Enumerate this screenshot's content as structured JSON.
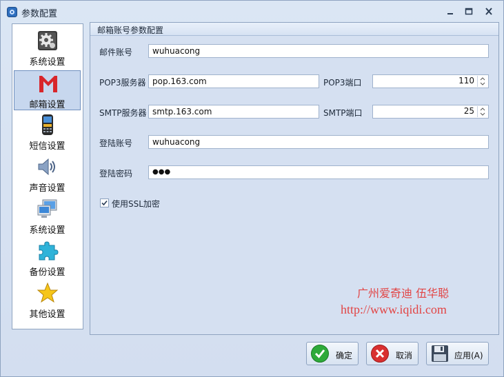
{
  "window": {
    "title": "参数配置"
  },
  "sidebar": {
    "items": [
      {
        "label": "系统设置",
        "icon": "gear-icon"
      },
      {
        "label": "邮箱设置",
        "icon": "gmail-icon",
        "active": true
      },
      {
        "label": "短信设置",
        "icon": "phone-icon"
      },
      {
        "label": "声音设置",
        "icon": "speaker-icon"
      },
      {
        "label": "系统设置",
        "icon": "computer-icon"
      },
      {
        "label": "备份设置",
        "icon": "puzzle-icon"
      },
      {
        "label": "其他设置",
        "icon": "star-icon"
      }
    ]
  },
  "panel": {
    "title": "邮箱账号参数配置"
  },
  "form": {
    "email_account_label": "邮件账号",
    "email_account_value": "wuhuacong",
    "pop3_server_label": "POP3服务器",
    "pop3_server_value": "pop.163.com",
    "pop3_port_label": "POP3端口",
    "pop3_port_value": "110",
    "smtp_server_label": "SMTP服务器",
    "smtp_server_value": "smtp.163.com",
    "smtp_port_label": "SMTP端口",
    "smtp_port_value": "25",
    "login_account_label": "登陆账号",
    "login_account_value": "wuhuacong",
    "login_password_label": "登陆密码",
    "login_password_value": "●●●",
    "ssl_label": "使用SSL加密",
    "ssl_checked": true
  },
  "watermark": {
    "line1": "广州爱奇迪 伍华聪",
    "line2": "http://www.iqidi.com"
  },
  "buttons": {
    "ok_label": "确定",
    "cancel_label": "取消",
    "apply_label": "应用(A)"
  },
  "colors": {
    "accent": "#6f8fbe",
    "watermark": "#e24444",
    "gmail_red": "#d8262b",
    "ok_green": "#2eaa3a",
    "cancel_red": "#d93030"
  }
}
